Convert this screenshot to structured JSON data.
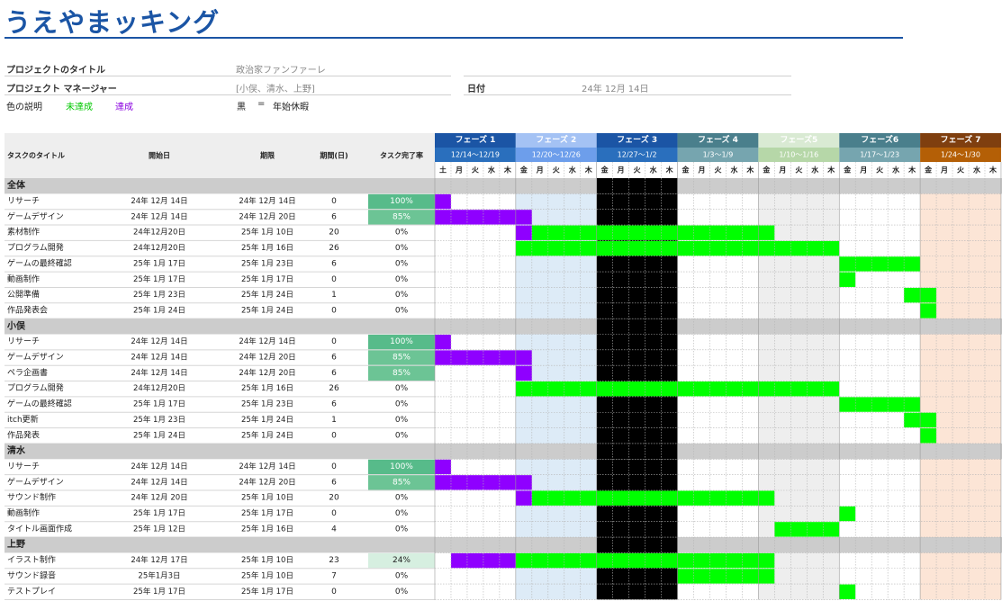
{
  "title": "うえやまッキング",
  "project": {
    "title_label": "プロジェクトのタイトル",
    "title_value": "政治家ファンファーレ",
    "manager_label": "プロジェクト マネージャー",
    "manager_value": "[小俣、清水、上野]",
    "date_label": "日付",
    "date_value": "24年 12月 14日"
  },
  "legend": {
    "label": "色の説明",
    "not_done": "未達成",
    "done": "達成",
    "black_label": "黒",
    "equals": "=",
    "black_meaning": "年始休暇"
  },
  "colors": {
    "accent": "#1b55a5",
    "bar_green": "#00ff00",
    "bar_purple": "#8f00ff",
    "holiday": "#000000",
    "section_bg": "#cccccc",
    "progress_100": "#57bb8a",
    "progress_85": "#6cc495",
    "progress_24": "#d6efe0"
  },
  "columns": [
    "タスクのタイトル",
    "開始日",
    "期限",
    "期間(日)",
    "タスク完了率"
  ],
  "phases": [
    {
      "name": "フェーズ 1",
      "range": "12/14～12/19",
      "days": [
        "土",
        "月",
        "火",
        "水",
        "木"
      ],
      "head": "#1b55a5",
      "sub": "#2a6fbd",
      "bg": "#ffffff",
      "fg": "#ffffff"
    },
    {
      "name": "フェーズ 2",
      "range": "12/20～12/26",
      "days": [
        "金",
        "月",
        "火",
        "水",
        "木"
      ],
      "head": "#a4c2f4",
      "sub": "#6d9eeb",
      "bg": "#ddebf7",
      "fg": "#ffffff"
    },
    {
      "name": "フェーズ 3",
      "range": "12/27～1/2",
      "days": [
        "金",
        "月",
        "火",
        "水",
        "木"
      ],
      "head": "#1b55a5",
      "sub": "#2a6fbd",
      "bg": "#000000",
      "fg": "#ffffff"
    },
    {
      "name": "フェーズ 4",
      "range": "1/3～1/9",
      "days": [
        "金",
        "月",
        "火",
        "水",
        "木"
      ],
      "head": "#4a7f8c",
      "sub": "#76a5af",
      "bg": "#ffffff",
      "fg": "#ffffff"
    },
    {
      "name": "フェーズ5",
      "range": "1/10～1/16",
      "days": [
        "金",
        "月",
        "火",
        "水",
        "木"
      ],
      "head": "#d9ead3",
      "sub": "#b6d7a8",
      "bg": "#eeeeee",
      "fg": "#ffffff"
    },
    {
      "name": "フェーズ6",
      "range": "1/17～1/23",
      "days": [
        "金",
        "月",
        "火",
        "水",
        "木"
      ],
      "head": "#4a7f8c",
      "sub": "#76a5af",
      "bg": "#ffffff",
      "fg": "#ffffff"
    },
    {
      "name": "フェーズ 7",
      "range": "1/24～1/30",
      "days": [
        "金",
        "月",
        "火",
        "水",
        "木"
      ],
      "head": "#7f3f0f",
      "sub": "#b45f06",
      "bg": "#fce5d6",
      "fg": "#ffffff"
    }
  ],
  "sections": [
    {
      "name": "全体",
      "tasks": [
        {
          "title": "リサーチ",
          "start": "24年 12月 14日",
          "end": "24年 12月 14日",
          "duration": "0",
          "progress": "100%",
          "pct": 100,
          "bar": {
            "color": "purple",
            "from": 0,
            "to": 1
          }
        },
        {
          "title": "ゲームデザイン",
          "start": "24年 12月 14日",
          "end": "24年 12月 20日",
          "duration": "6",
          "progress": "85%",
          "pct": 85,
          "bar": {
            "color": "purple",
            "from": 0,
            "to": 6
          }
        },
        {
          "title": "素材制作",
          "start": "24年12月20日",
          "end": "25年 1月 10日",
          "duration": "20",
          "progress": "0%",
          "pct": 0,
          "segments": [
            {
              "color": "purple",
              "from": 5,
              "to": 6
            },
            {
              "color": "green",
              "from": 6,
              "to": 21
            }
          ]
        },
        {
          "title": "プログラム開発",
          "start": "24年12月20日",
          "end": "25年 1月 16日",
          "duration": "26",
          "progress": "0%",
          "pct": 0,
          "bar": {
            "color": "green",
            "from": 5,
            "to": 25
          }
        },
        {
          "title": "ゲームの最終確認",
          "start": "25年 1月 17日",
          "end": "25年 1月 23日",
          "duration": "6",
          "progress": "0%",
          "pct": 0,
          "bar": {
            "color": "green",
            "from": 25,
            "to": 30
          }
        },
        {
          "title": "動画制作",
          "start": "25年 1月 17日",
          "end": "25年 1月 17日",
          "duration": "0",
          "progress": "0%",
          "pct": 0,
          "bar": {
            "color": "green",
            "from": 25,
            "to": 26
          }
        },
        {
          "title": "公開準備",
          "start": "25年 1月 23日",
          "end": "25年 1月 24日",
          "duration": "1",
          "progress": "0%",
          "pct": 0,
          "bar": {
            "color": "green",
            "from": 29,
            "to": 31
          }
        },
        {
          "title": "作品発表会",
          "start": "25年 1月 24日",
          "end": "25年 1月 24日",
          "duration": "0",
          "progress": "0%",
          "pct": 0,
          "bar": {
            "color": "green",
            "from": 30,
            "to": 31
          }
        }
      ]
    },
    {
      "name": "小俣",
      "tasks": [
        {
          "title": "リサーチ",
          "start": "24年 12月 14日",
          "end": "24年 12月 14日",
          "duration": "0",
          "progress": "100%",
          "pct": 100,
          "bar": {
            "color": "purple",
            "from": 0,
            "to": 1
          }
        },
        {
          "title": "ゲームデザイン",
          "start": "24年 12月 14日",
          "end": "24年 12月 20日",
          "duration": "6",
          "progress": "85%",
          "pct": 85,
          "bar": {
            "color": "purple",
            "from": 0,
            "to": 6
          }
        },
        {
          "title": "ペラ企画書",
          "start": "24年 12月 14日",
          "end": "24年 12月 20日",
          "duration": "6",
          "progress": "85%",
          "pct": 85,
          "bar": {
            "color": "purple",
            "from": 5,
            "to": 6
          }
        },
        {
          "title": "プログラム開発",
          "start": "24年12月20日",
          "end": "25年 1月 16日",
          "duration": "26",
          "progress": "0%",
          "pct": 0,
          "bar": {
            "color": "green",
            "from": 5,
            "to": 25
          }
        },
        {
          "title": "ゲームの最終確認",
          "start": "25年 1月 17日",
          "end": "25年 1月 23日",
          "duration": "6",
          "progress": "0%",
          "pct": 0,
          "bar": {
            "color": "green",
            "from": 25,
            "to": 30
          }
        },
        {
          "title": "itch更新",
          "start": "25年 1月 23日",
          "end": "25年 1月 24日",
          "duration": "1",
          "progress": "0%",
          "pct": 0,
          "bar": {
            "color": "green",
            "from": 29,
            "to": 31
          }
        },
        {
          "title": "作品発表",
          "start": "25年 1月 24日",
          "end": "25年 1月 24日",
          "duration": "0",
          "progress": "0%",
          "pct": 0,
          "bar": {
            "color": "green",
            "from": 30,
            "to": 31
          }
        }
      ]
    },
    {
      "name": "清水",
      "tasks": [
        {
          "title": "リサーチ",
          "start": "24年 12月 14日",
          "end": "24年 12月 14日",
          "duration": "0",
          "progress": "100%",
          "pct": 100,
          "bar": {
            "color": "purple",
            "from": 0,
            "to": 1
          }
        },
        {
          "title": "ゲームデザイン",
          "start": "24年 12月 14日",
          "end": "24年 12月 20日",
          "duration": "6",
          "progress": "85%",
          "pct": 85,
          "bar": {
            "color": "purple",
            "from": 0,
            "to": 6
          }
        },
        {
          "title": "サウンド制作",
          "start": "24年 12月 20日",
          "end": "25年 1月 10日",
          "duration": "20",
          "progress": "0%",
          "pct": 0,
          "segments": [
            {
              "color": "purple",
              "from": 5,
              "to": 6
            },
            {
              "color": "green",
              "from": 6,
              "to": 21
            }
          ]
        },
        {
          "title": "動画制作",
          "start": "25年 1月 17日",
          "end": "25年 1月 17日",
          "duration": "0",
          "progress": "0%",
          "pct": 0,
          "bar": {
            "color": "green",
            "from": 25,
            "to": 26
          }
        },
        {
          "title": "タイトル画面作成",
          "start": "25年 1月 12日",
          "end": "25年 1月 16日",
          "duration": "4",
          "progress": "0%",
          "pct": 0,
          "bar": {
            "color": "green",
            "from": 21,
            "to": 25
          }
        }
      ]
    },
    {
      "name": "上野",
      "tasks": [
        {
          "title": "イラスト制作",
          "start": "24年 12月 17日",
          "end": "25年 1月 10日",
          "duration": "23",
          "progress": "24%",
          "pct": 24,
          "segments": [
            {
              "color": "purple",
              "from": 1,
              "to": 5
            },
            {
              "color": "green",
              "from": 5,
              "to": 21
            }
          ]
        },
        {
          "title": "サウンド録音",
          "start": "25年1月3日",
          "end": "25年 1月 10日",
          "duration": "7",
          "progress": "0%",
          "pct": 0,
          "bar": {
            "color": "green",
            "from": 15,
            "to": 21
          }
        },
        {
          "title": "テストプレイ",
          "start": "25年 1月 17日",
          "end": "25年 1月 17日",
          "duration": "0",
          "progress": "0%",
          "pct": 0,
          "bar": {
            "color": "green",
            "from": 25,
            "to": 26
          }
        }
      ]
    }
  ]
}
